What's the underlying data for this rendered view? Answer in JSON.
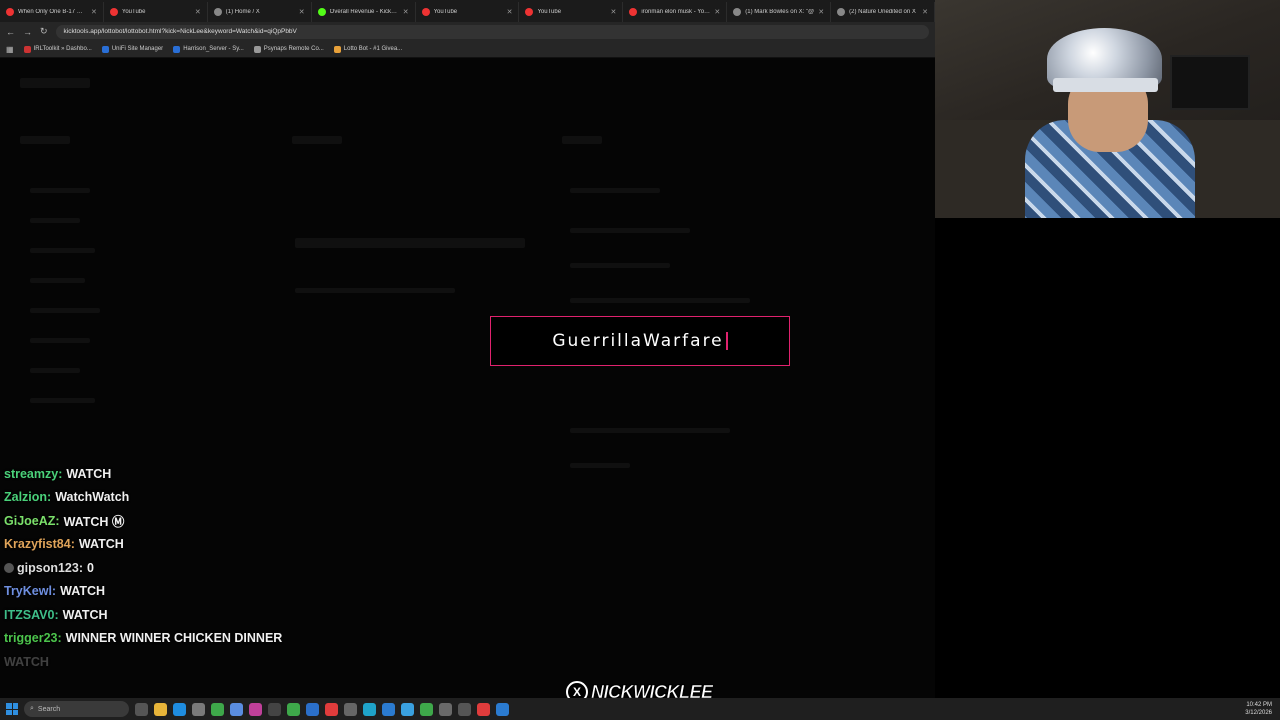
{
  "browser": {
    "tabs": [
      {
        "title": "When Only One B-17 Can",
        "color": "#e33"
      },
      {
        "title": "YouTube",
        "color": "#e33"
      },
      {
        "title": "(1) Home / X",
        "color": "#888"
      },
      {
        "title": "Overall Revenue - Kick Da",
        "color": "#53fc18"
      },
      {
        "title": "YouTube",
        "color": "#e33"
      },
      {
        "title": "YouTube",
        "color": "#e33"
      },
      {
        "title": "ironman elon musk - YouTu",
        "color": "#e33"
      },
      {
        "title": "(1) Mark Bowles on X: \"@",
        "color": "#888"
      },
      {
        "title": "(2) Nature Unedited on X",
        "color": "#888"
      }
    ],
    "url": "kicktools.app/lottobot/lottobot.html?kick=NickLee&keyword=Watch&id=qiQpPbbV",
    "bookmarks": [
      {
        "label": "IRLToolkit » Dashbo...",
        "color": "#c33"
      },
      {
        "label": "UniFi Site Manager",
        "color": "#2a6fd6"
      },
      {
        "label": "Harrison_Server - Sy...",
        "color": "#2a6fd6"
      },
      {
        "label": "Psynaps Remote Co...",
        "color": "#999"
      },
      {
        "label": "Lotto Bot - #1 Givea...",
        "color": "#e8a13a"
      }
    ]
  },
  "winner_modal": {
    "name": "GuerrillaWarfare",
    "accent": "#e0226e"
  },
  "chat": [
    {
      "user": "streamzy:",
      "text": "WATCH",
      "color": "#4ad17a",
      "fade": false,
      "badge": false
    },
    {
      "user": "Zalzion:",
      "text": "WatchWatch",
      "color": "#4ad17a",
      "fade": false,
      "badge": false
    },
    {
      "user": "GiJoeAZ:",
      "text": "WATCH Ⓜ",
      "color": "#7be06b",
      "fade": false,
      "badge": false
    },
    {
      "user": "Krazyfist84:",
      "text": "WATCH",
      "color": "#e0a45a",
      "fade": false,
      "badge": false
    },
    {
      "user": "gipson123:",
      "text": "0",
      "color": "#dddddd",
      "fade": false,
      "badge": true
    },
    {
      "user": "TryKewl:",
      "text": "WATCH",
      "color": "#6f8fe0",
      "fade": false,
      "badge": false
    },
    {
      "user": "ITZSAV0:",
      "text": "WATCH",
      "color": "#3fbf8a",
      "fade": false,
      "badge": false
    },
    {
      "user": "trigger23:",
      "text": "WINNER WINNER CHICKEN DINNER",
      "color": "#4cc44c",
      "fade": false,
      "badge": false
    },
    {
      "user": "",
      "text": "WATCH",
      "color": "#4ad17a",
      "fade": true,
      "badge": false
    }
  ],
  "logo": {
    "text": "NICKWICKLEE",
    "mark": "X"
  },
  "taskbar": {
    "search_placeholder": "Search",
    "time": "10:42 PM",
    "date": "3/12/2026"
  }
}
